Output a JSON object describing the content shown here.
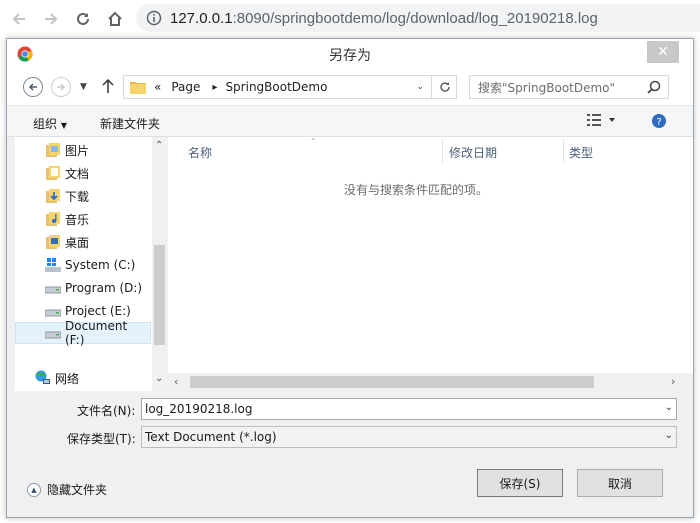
{
  "browser": {
    "url_host": "127.0.0.1",
    "url_path": ":8090/springbootdemo/log/download/log_20190218.log"
  },
  "dialog": {
    "title": "另存为",
    "close_glyph": "✕",
    "breadcrumb": {
      "overflow": "«",
      "items": [
        "Page",
        "SpringBootDemo"
      ]
    },
    "search_placeholder": "搜索\"SpringBootDemo\"",
    "toolbar": {
      "organize": "组织",
      "new_folder": "新建文件夹"
    },
    "nav_items": [
      {
        "label": "图片",
        "icon": "pictures-folder-icon"
      },
      {
        "label": "文档",
        "icon": "documents-folder-icon"
      },
      {
        "label": "下载",
        "icon": "downloads-folder-icon"
      },
      {
        "label": "音乐",
        "icon": "music-folder-icon"
      },
      {
        "label": "桌面",
        "icon": "desktop-folder-icon"
      },
      {
        "label": "System (C:)",
        "icon": "system-drive-icon"
      },
      {
        "label": "Program (D:)",
        "icon": "drive-icon"
      },
      {
        "label": "Project (E:)",
        "icon": "drive-icon"
      },
      {
        "label": "Document (F:)",
        "icon": "drive-icon",
        "selected": true
      },
      {
        "label": "网络",
        "icon": "network-icon"
      }
    ],
    "columns": [
      "名称",
      "修改日期",
      "类型"
    ],
    "empty_message": "没有与搜索条件匹配的项。",
    "filename_label": "文件名(N):",
    "filename_value": "log_20190218.log",
    "filetype_label": "保存类型(T):",
    "filetype_value": "Text Document (*.log)",
    "hide_folders": "隐藏文件夹",
    "save_button": "保存(S)",
    "cancel_button": "取消"
  }
}
